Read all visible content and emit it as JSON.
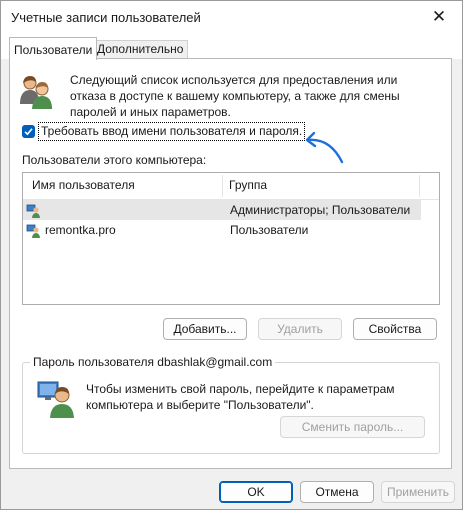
{
  "window": {
    "title": "Учетные записи пользователей",
    "close_glyph": "✕"
  },
  "tabs": [
    {
      "label": "Пользователи",
      "active": true
    },
    {
      "label": "Дополнительно",
      "active": false
    }
  ],
  "intro": {
    "icon": "users-icon",
    "text": "Следующий список используется для предоставления или отказа в доступе к вашему компьютеру, а также для смены паролей и иных параметров."
  },
  "require_login": {
    "checked": true,
    "label": "Требовать ввод имени пользователя и пароля."
  },
  "annotation": {
    "color": "#1e6fd9"
  },
  "users": {
    "label": "Пользователи этого компьютера:",
    "columns": [
      "Имя пользователя",
      "Группа"
    ],
    "rows": [
      {
        "name": "",
        "group": "Администраторы; Пользователи",
        "selected": true
      },
      {
        "name": "remontka.pro",
        "group": "Пользователи",
        "selected": false
      }
    ]
  },
  "list_buttons": {
    "add": "Добавить...",
    "remove": "Удалить",
    "properties": "Свойства"
  },
  "password": {
    "group_title": "Пароль пользователя dbashlak@gmail.com",
    "text": "Чтобы изменить свой пароль, перейдите к параметрам компьютера и выберите \"Пользователи\".",
    "button": "Сменить пароль..."
  },
  "dialog_buttons": {
    "ok": "OK",
    "cancel": "Отмена",
    "apply": "Применить"
  },
  "colors": {
    "accent": "#005fb8",
    "selected_row": "#e6e6e6"
  }
}
